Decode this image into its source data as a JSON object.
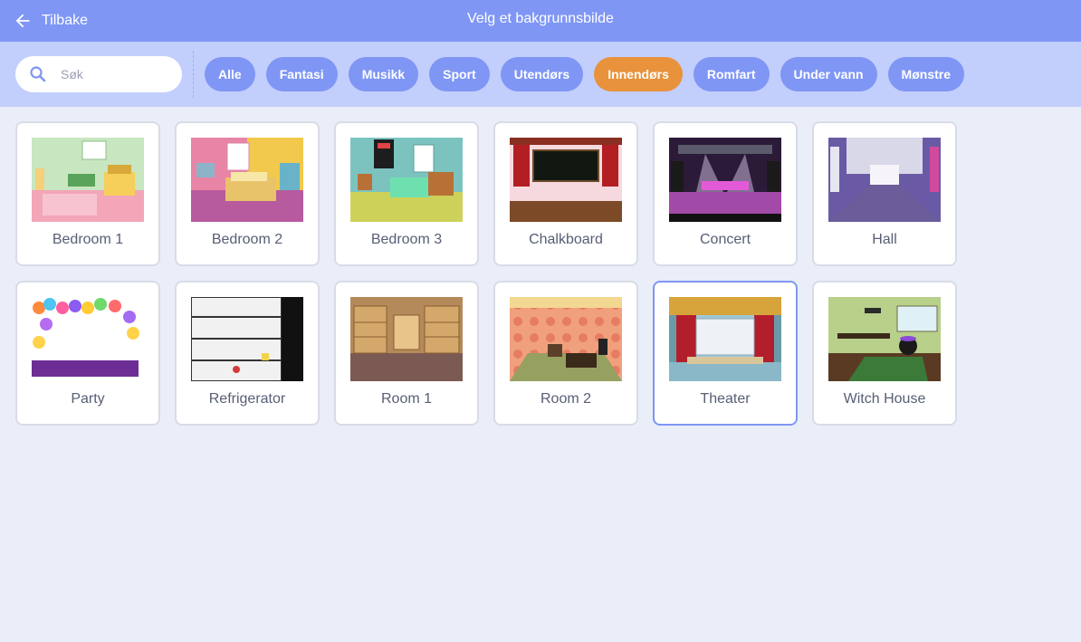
{
  "header": {
    "back_label": "Tilbake",
    "title": "Velg et bakgrunnsbilde"
  },
  "search": {
    "placeholder": "Søk",
    "value": ""
  },
  "categories": [
    {
      "label": "Alle"
    },
    {
      "label": "Fantasi"
    },
    {
      "label": "Musikk"
    },
    {
      "label": "Sport"
    },
    {
      "label": "Utendørs"
    },
    {
      "label": "Innendørs",
      "active": true
    },
    {
      "label": "Romfart"
    },
    {
      "label": "Under vann"
    },
    {
      "label": "Mønstre"
    }
  ],
  "backdrops": [
    {
      "label": "Bedroom 1"
    },
    {
      "label": "Bedroom 2"
    },
    {
      "label": "Bedroom 3"
    },
    {
      "label": "Chalkboard"
    },
    {
      "label": "Concert"
    },
    {
      "label": "Hall"
    },
    {
      "label": "Party"
    },
    {
      "label": "Refrigerator"
    },
    {
      "label": "Room 1"
    },
    {
      "label": "Room 2"
    },
    {
      "label": "Theater",
      "selected": true
    },
    {
      "label": "Witch House"
    }
  ],
  "colors": {
    "header_bg": "#7f96f5",
    "filter_bg": "#c2cefc",
    "pill": "#7f96f5",
    "pill_active": "#e8923b",
    "body_bg": "#e9eef8",
    "selected_border": "#7f96f5"
  },
  "icons": {
    "back": "arrow-left-icon",
    "search": "search-icon"
  }
}
